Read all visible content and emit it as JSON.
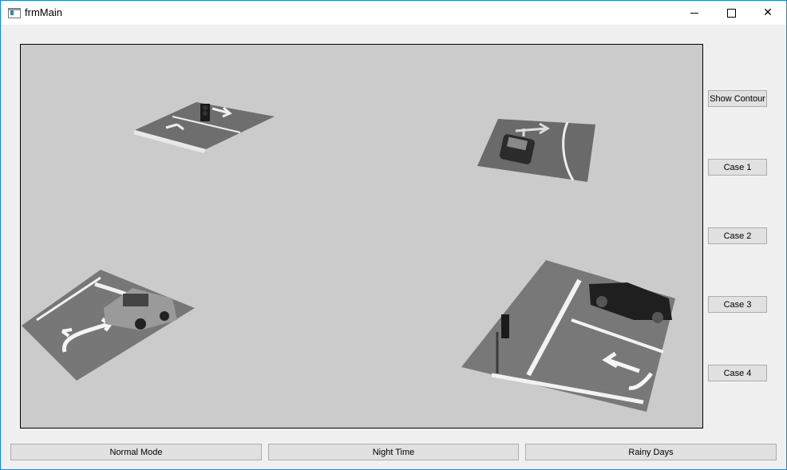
{
  "window": {
    "title": "frmMain",
    "controls": {
      "minimize": "minimize-icon",
      "maximize": "maximize-icon",
      "close": "close-icon",
      "close_glyph": "✕"
    }
  },
  "side_buttons": {
    "show_contour": "Show Contour",
    "case1": "Case 1",
    "case2": "Case 2",
    "case3": "Case 3",
    "case4": "Case 4"
  },
  "bottom_buttons": {
    "normal_mode": "Normal Mode",
    "night_time": "Night Time",
    "rainy_days": "Rainy Days"
  }
}
